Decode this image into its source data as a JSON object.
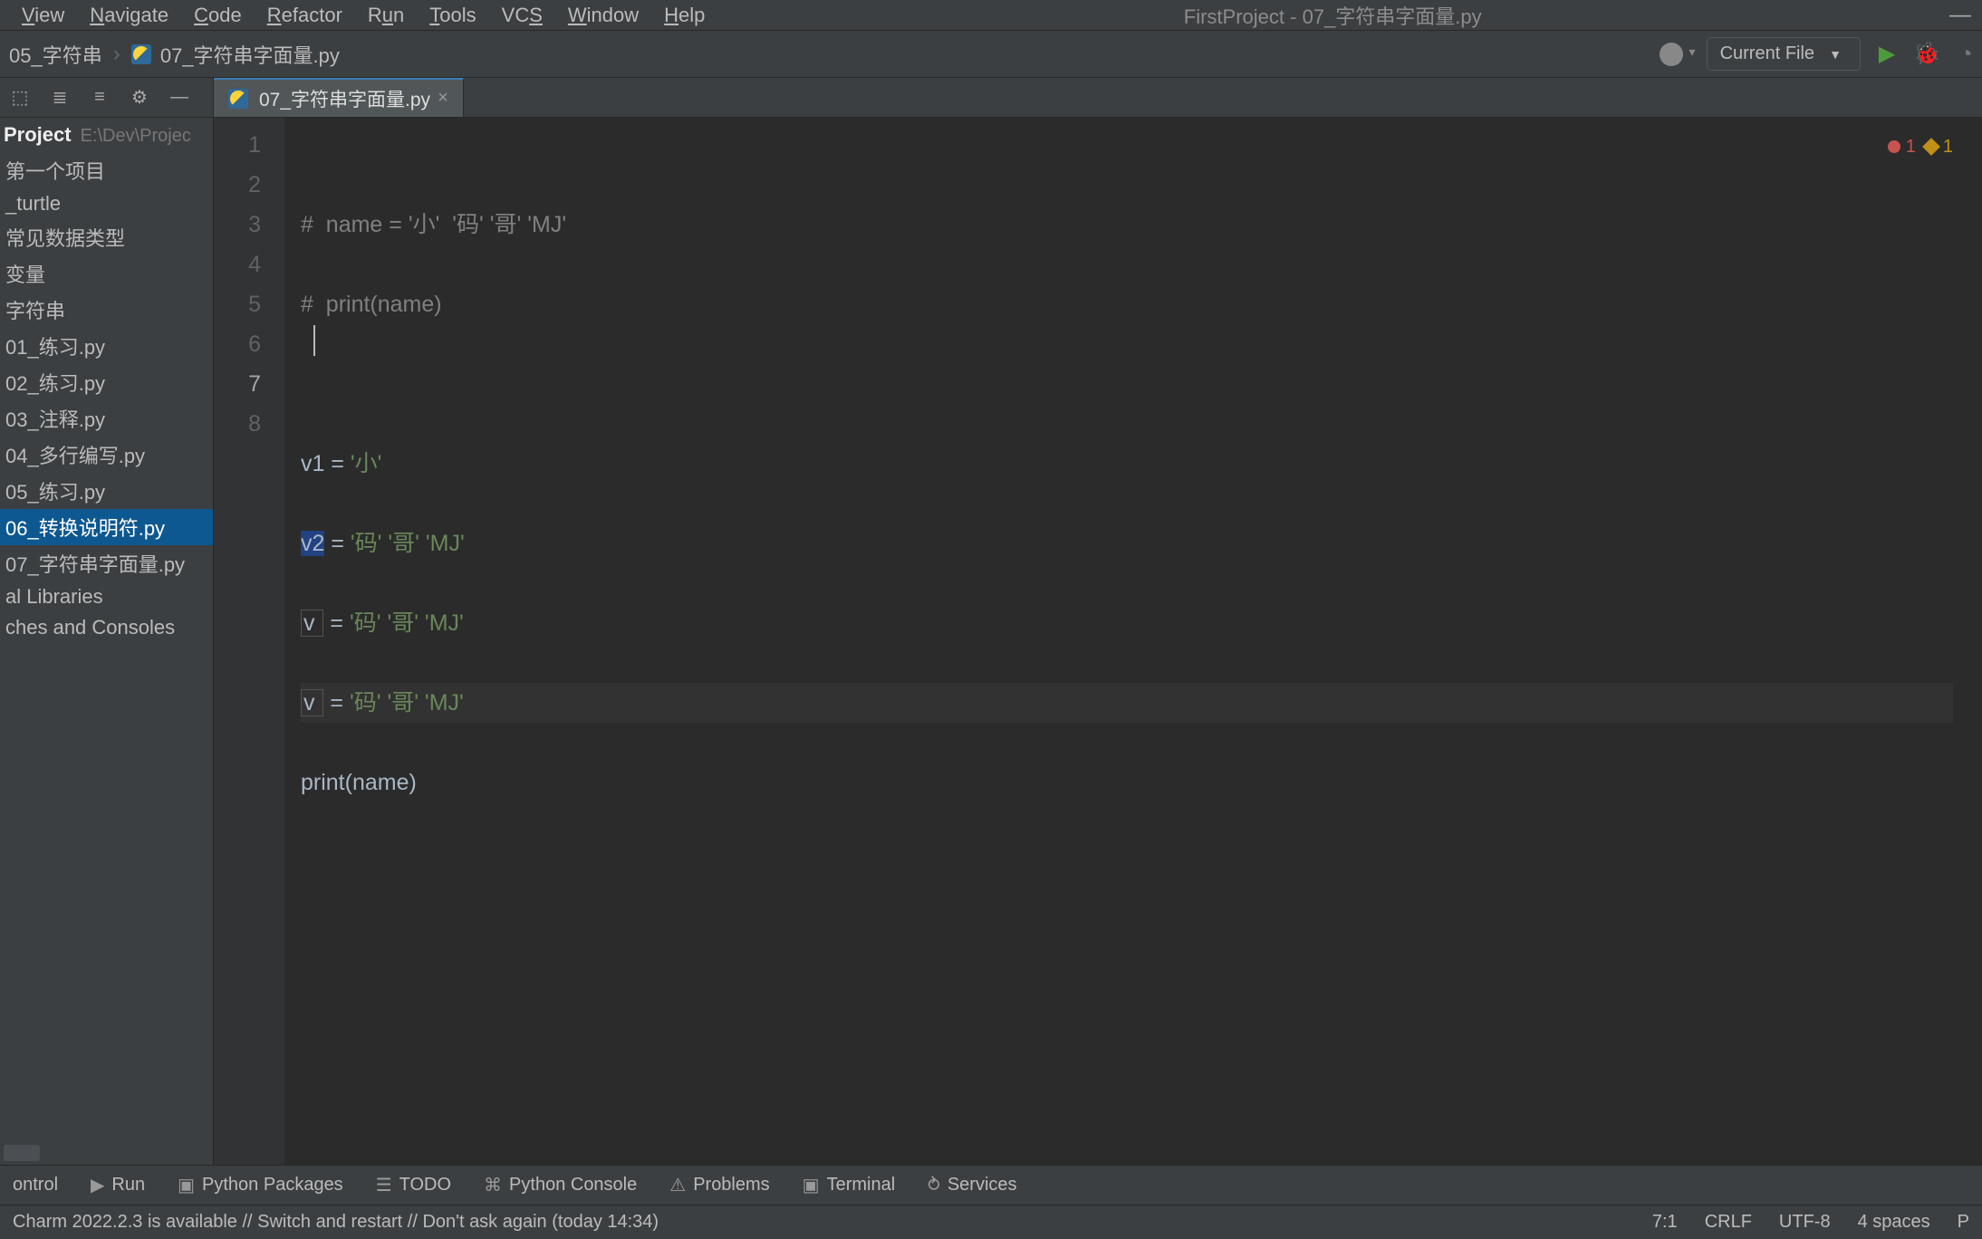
{
  "menus": [
    "View",
    "Navigate",
    "Code",
    "Refactor",
    "Run",
    "Tools",
    "VCS",
    "Window",
    "Help"
  ],
  "window_title": "FirstProject - 07_字符串字面量.py",
  "breadcrumbs": {
    "parent": "05_字符串",
    "file": "07_字符串字面量.py"
  },
  "run_config": "Current File",
  "project": {
    "label": "Project",
    "path": "E:\\Dev\\Projec"
  },
  "tree": [
    {
      "label": "第一个项目"
    },
    {
      "label": "_turtle"
    },
    {
      "label": "常见数据类型"
    },
    {
      "label": "变量"
    },
    {
      "label": "字符串"
    },
    {
      "label": "01_练习.py"
    },
    {
      "label": "02_练习.py"
    },
    {
      "label": "03_注释.py"
    },
    {
      "label": "04_多行编写.py"
    },
    {
      "label": "05_练习.py"
    },
    {
      "label": "06_转换说明符.py",
      "selected": true
    },
    {
      "label": "07_字符串字面量.py"
    },
    {
      "label": "al Libraries"
    },
    {
      "label": "ches and Consoles"
    }
  ],
  "tab": {
    "label": "07_字符串字面量.py"
  },
  "inspection": {
    "errors": "1",
    "warnings": "1"
  },
  "code": {
    "l1": {
      "a": "#  name = ",
      "b": "'小'  '码' '哥' 'MJ'"
    },
    "l2": {
      "a": "#  print(name)"
    },
    "l4": {
      "v": "v1",
      "eq": " = ",
      "s": "'小'"
    },
    "l5": {
      "v": "v2",
      "eq": " = ",
      "s": "'码' '哥' 'MJ'"
    },
    "l6": {
      "v": "v ",
      "eq": " = ",
      "s": "'码' '哥' 'MJ'"
    },
    "l7": {
      "v": "v ",
      "eq": " = ",
      "s": "'码' '哥' 'MJ'"
    },
    "l8": {
      "f": "print",
      "p": "(",
      "n": "name",
      "q": ")"
    }
  },
  "gutter": [
    "1",
    "2",
    "3",
    "4",
    "5",
    "6",
    "7",
    "8"
  ],
  "toolbar": {
    "control": "ontrol",
    "run": "Run",
    "packages": "Python Packages",
    "todo": "TODO",
    "console": "Python Console",
    "problems": "Problems",
    "terminal": "Terminal",
    "services": "Services"
  },
  "status": {
    "msg": "Charm 2022.2.3 is available // Switch and restart // Don't ask again (today 14:34)",
    "pos": "7:1",
    "eol": "CRLF",
    "enc": "UTF-8",
    "indent": "4 spaces",
    "lang": "P"
  }
}
